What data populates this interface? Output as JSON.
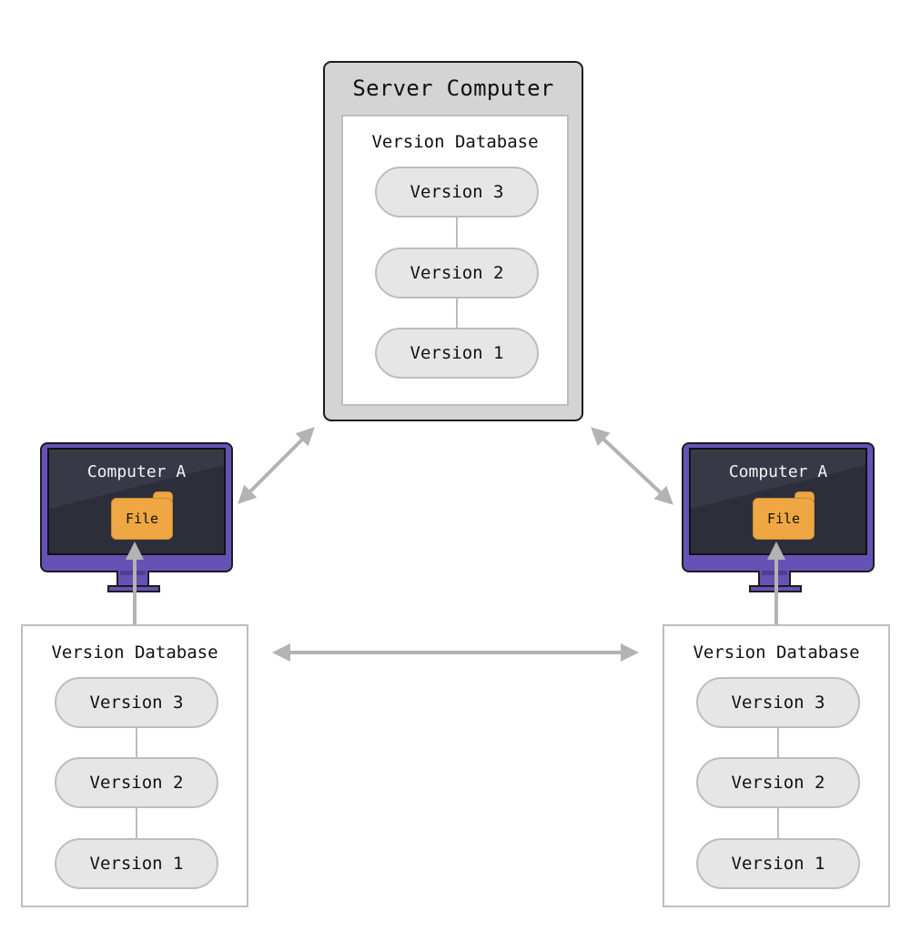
{
  "colors": {
    "arrow": "#b3b3b3",
    "server_bg": "#d4d4d4",
    "pill_bg": "#e6e6e6",
    "monitor": "#6652b6",
    "screen": "#2c2f3a",
    "folder": "#efa744"
  },
  "server": {
    "title": "Server Computer",
    "database": {
      "title": "Version Database",
      "versions": [
        "Version 3",
        "Version 2",
        "Version 1"
      ]
    }
  },
  "computers": [
    {
      "title": "Computer A",
      "file_label": "File",
      "file_icon": "folder-icon",
      "database": {
        "title": "Version Database",
        "versions": [
          "Version 3",
          "Version 2",
          "Version 1"
        ]
      }
    },
    {
      "title": "Computer A",
      "file_label": "File",
      "file_icon": "folder-icon",
      "database": {
        "title": "Version Database",
        "versions": [
          "Version 3",
          "Version 2",
          "Version 1"
        ]
      }
    }
  ],
  "connections": [
    {
      "from": "server",
      "to": "computer-left",
      "type": "bidirectional"
    },
    {
      "from": "server",
      "to": "computer-right",
      "type": "bidirectional"
    },
    {
      "from": "local-db-left",
      "to": "local-db-right",
      "type": "bidirectional"
    },
    {
      "from": "local-db-left",
      "to": "file-left",
      "type": "checkout"
    },
    {
      "from": "local-db-right",
      "to": "file-right",
      "type": "checkout"
    }
  ]
}
